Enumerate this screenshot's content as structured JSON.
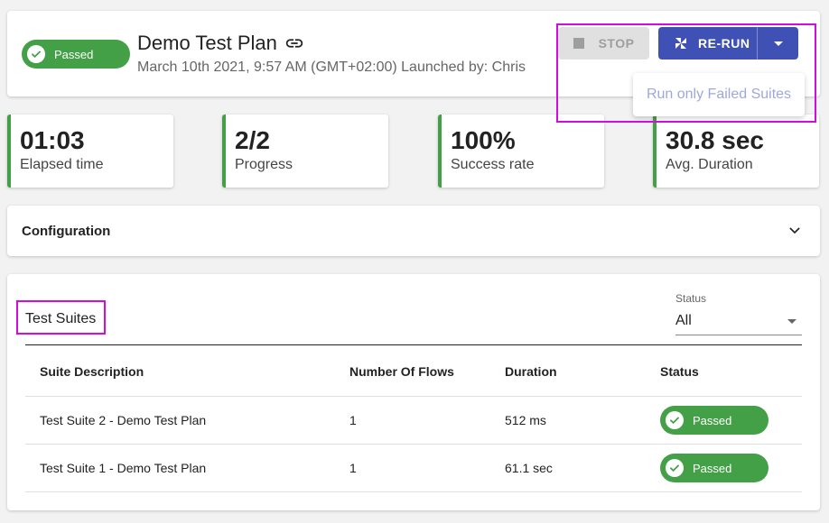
{
  "header": {
    "status": "Passed",
    "title": "Demo Test Plan",
    "meta": "March 10th 2021, 9:57 AM (GMT+02:00) Launched by: Chris",
    "stop_label": "STOP",
    "rerun_label": "RE-RUN",
    "rerun_menu_item": "Run only Failed Suites"
  },
  "stats": [
    {
      "value": "01:03",
      "label": "Elapsed time"
    },
    {
      "value": "2/2",
      "label": "Progress"
    },
    {
      "value": "100%",
      "label": "Success rate"
    },
    {
      "value": "30.8 sec",
      "label": "Avg. Duration"
    }
  ],
  "config": {
    "title": "Configuration"
  },
  "suites": {
    "title": "Test Suites",
    "filter_label": "Status",
    "filter_value": "All",
    "columns": [
      "Suite Description",
      "Number Of Flows",
      "Duration",
      "Status"
    ],
    "rows": [
      {
        "description": "Test Suite 2 - Demo Test Plan",
        "flows": "1",
        "duration": "512 ms",
        "status": "Passed"
      },
      {
        "description": "Test Suite 1 - Demo Test Plan",
        "flows": "1",
        "duration": "61.1 sec",
        "status": "Passed"
      }
    ]
  },
  "colors": {
    "passed": "#43a047",
    "primary": "#3f51b5",
    "highlight": "#d20be0"
  }
}
